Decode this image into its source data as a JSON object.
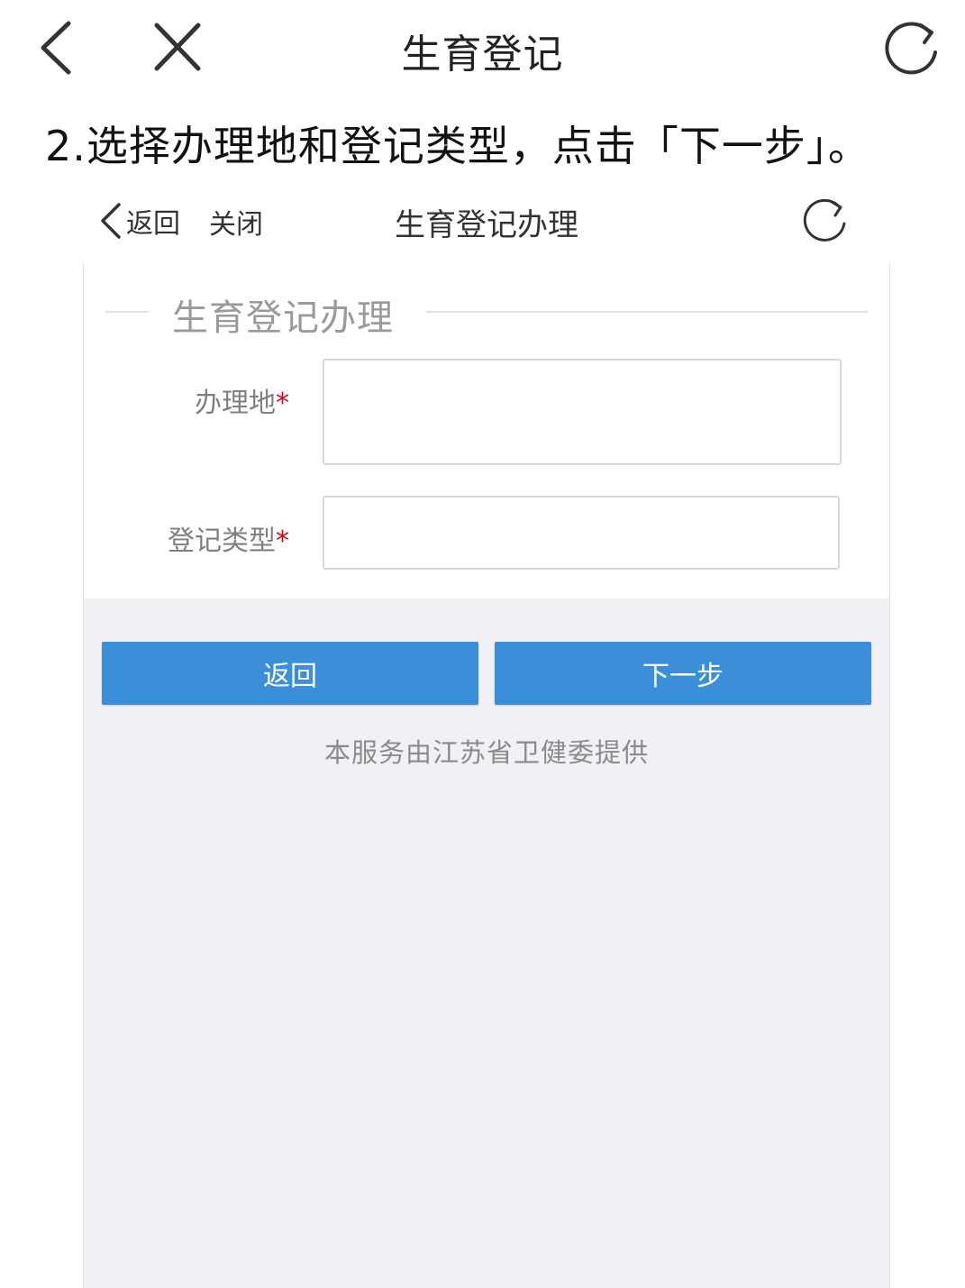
{
  "app_header": {
    "title": "生育登记",
    "back_icon": "chevron-left-icon",
    "close_icon": "close-icon",
    "refresh_icon": "refresh-icon"
  },
  "instruction": "2.选择办理地和登记类型，点击「下一步」。",
  "inner_header": {
    "back_label": "返回",
    "close_label": "关闭",
    "title": "生育登记办理"
  },
  "form": {
    "legend": "生育登记办理",
    "fields": [
      {
        "label": "办理地",
        "required_mark": "*",
        "value": ""
      },
      {
        "label": "登记类型",
        "required_mark": "*",
        "value": ""
      }
    ]
  },
  "buttons": {
    "back_label": "返回",
    "next_label": "下一步"
  },
  "footer_note": "本服务由江苏省卫健委提供",
  "colors": {
    "primary_button": "#3a8fd8",
    "required_mark": "#d0021b",
    "page_background": "#f1f1f5"
  }
}
